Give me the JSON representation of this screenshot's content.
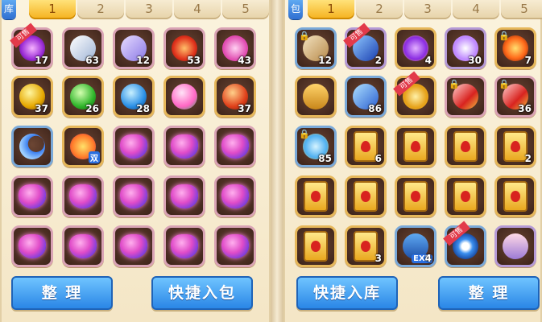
{
  "left": {
    "tag": "库",
    "tabs": [
      "1",
      "2",
      "3",
      "4",
      "5"
    ],
    "active_tab": 0,
    "slots": [
      {
        "icon": "purple-flame-icon",
        "count": "17",
        "sale": true,
        "frame": "pink"
      },
      {
        "icon": "silver-horn-icon",
        "count": "63",
        "frame": "pink"
      },
      {
        "icon": "crystal-wing-icon",
        "count": "12",
        "frame": "pink"
      },
      {
        "icon": "red-sword-orb-icon",
        "count": "53",
        "frame": "pink"
      },
      {
        "icon": "pink-paw-stone-icon",
        "count": "43",
        "frame": "pink"
      },
      {
        "icon": "yellow-orb-icon",
        "count": "37",
        "frame": "gold"
      },
      {
        "icon": "green-orb-icon",
        "count": "26",
        "frame": "gold"
      },
      {
        "icon": "blue-arrow-orb-icon",
        "count": "28",
        "frame": "gold"
      },
      {
        "icon": "pink-bloom-orb-icon",
        "count": "",
        "frame": "gold"
      },
      {
        "icon": "red-paw-orb-icon",
        "count": "37",
        "frame": "gold"
      },
      {
        "icon": "blue-crescent-icon",
        "count": "",
        "frame": "blue"
      },
      {
        "icon": "double-gem-icon",
        "count": "",
        "badge": "双",
        "frame": "gold"
      },
      {
        "icon": "crystal-heart-icon",
        "count": "",
        "frame": "pink"
      },
      {
        "icon": "crystal-heart-icon",
        "count": "",
        "frame": "pink"
      },
      {
        "icon": "crystal-heart-icon",
        "count": "",
        "frame": "pink"
      },
      {
        "icon": "crystal-heart-icon",
        "count": "",
        "frame": "pink"
      },
      {
        "icon": "crystal-heart-icon",
        "count": "",
        "frame": "pink"
      },
      {
        "icon": "crystal-heart-icon",
        "count": "",
        "frame": "pink"
      },
      {
        "icon": "crystal-heart-icon",
        "count": "",
        "frame": "pink"
      },
      {
        "icon": "crystal-heart-icon",
        "count": "",
        "frame": "pink"
      },
      {
        "icon": "crystal-heart-icon",
        "count": "",
        "frame": "pink"
      },
      {
        "icon": "crystal-heart-icon",
        "count": "",
        "frame": "pink"
      },
      {
        "icon": "crystal-heart-icon",
        "count": "",
        "frame": "pink"
      },
      {
        "icon": "crystal-heart-icon",
        "count": "",
        "frame": "pink"
      },
      {
        "icon": "crystal-heart-icon",
        "count": "",
        "frame": "pink"
      }
    ],
    "buttons": {
      "sort": "整  理",
      "quick": "快捷入包"
    }
  },
  "right": {
    "tag": "包",
    "tabs": [
      "1",
      "2",
      "3",
      "4",
      "5"
    ],
    "active_tab": 0,
    "slots": [
      {
        "icon": "spell-book-icon",
        "count": "12",
        "lock": true,
        "frame": "blue"
      },
      {
        "icon": "blue-crystal-icon",
        "count": "2",
        "sale": true,
        "frame": "purple"
      },
      {
        "icon": "purple-potion-orb-icon",
        "count": "4",
        "frame": "gold"
      },
      {
        "icon": "candy-icon",
        "count": "30",
        "frame": "purple"
      },
      {
        "icon": "fire-ring-icon",
        "count": "7",
        "lock": true,
        "frame": "gold"
      },
      {
        "icon": "treasure-chest-icon",
        "count": "",
        "frame": "gold"
      },
      {
        "icon": "blue-shard-icon",
        "count": "86",
        "frame": "blue"
      },
      {
        "icon": "gold-medal-icon",
        "count": "",
        "sale": true,
        "frame": "gold"
      },
      {
        "icon": "red-vial-icon",
        "count": "",
        "lock": true,
        "frame": "pink"
      },
      {
        "icon": "red-vial-icon",
        "count": "36",
        "lock": true,
        "frame": "pink"
      },
      {
        "icon": "blue-potion-icon",
        "count": "85",
        "lock": true,
        "frame": "blue"
      },
      {
        "icon": "fire-card-icon",
        "count": "6",
        "frame": "gold"
      },
      {
        "icon": "fire-card-icon",
        "count": "",
        "frame": "gold"
      },
      {
        "icon": "fire-card-icon",
        "count": "",
        "frame": "gold"
      },
      {
        "icon": "fire-card-icon",
        "count": "2",
        "frame": "gold"
      },
      {
        "icon": "bomb-card-icon",
        "count": "",
        "frame": "gold"
      },
      {
        "icon": "bomb-card-icon",
        "count": "",
        "frame": "gold"
      },
      {
        "icon": "bomb-card-icon",
        "count": "",
        "frame": "gold"
      },
      {
        "icon": "bomb-card-icon",
        "count": "",
        "frame": "gold"
      },
      {
        "icon": "bomb-card-icon",
        "count": "",
        "frame": "gold"
      },
      {
        "icon": "bomb-card-icon",
        "count": "",
        "frame": "gold"
      },
      {
        "icon": "bomb-card-icon",
        "count": "3",
        "frame": "gold"
      },
      {
        "icon": "exp-card-icon",
        "count": "4",
        "badge": "EXP",
        "frame": "blue"
      },
      {
        "icon": "blue-gear-icon",
        "count": "",
        "sale": true,
        "frame": "blue"
      },
      {
        "icon": "character-portrait-icon",
        "count": "",
        "frame": "purple"
      }
    ],
    "buttons": {
      "quick": "快捷入库",
      "sort": "整  理"
    }
  },
  "labels": {
    "sale": "可售"
  },
  "colors": {
    "active_tab": "#f5b11c",
    "button": "#2a86e6",
    "slot_bg": "#3b2219",
    "sale_ribbon": "#e23a4a"
  }
}
